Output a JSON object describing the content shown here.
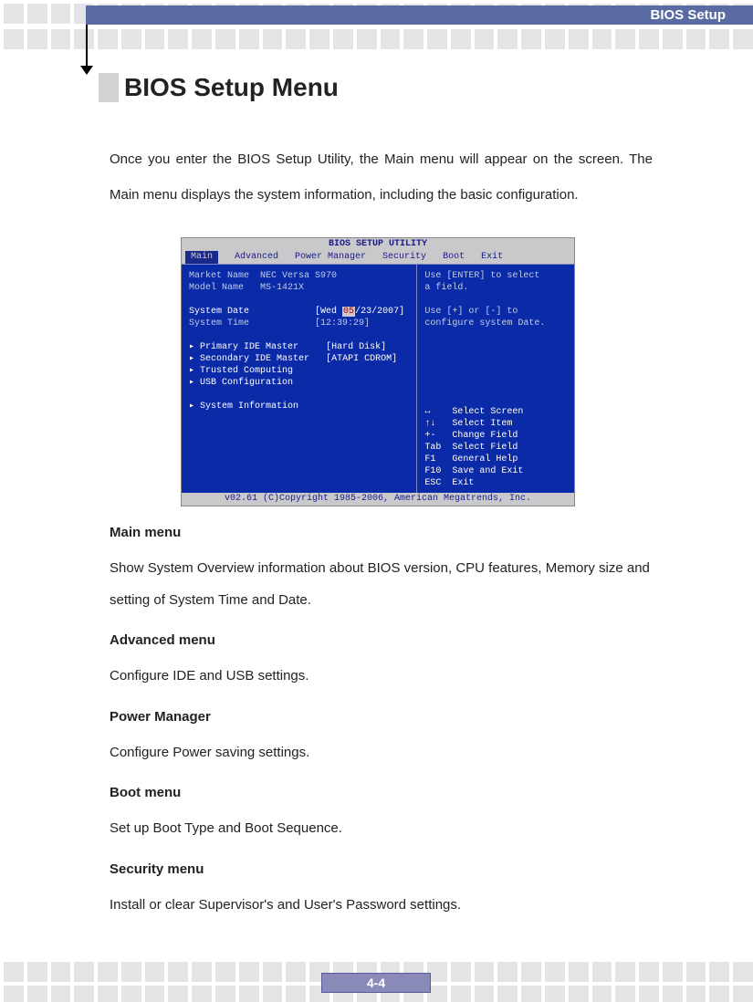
{
  "header": {
    "title": "BIOS Setup"
  },
  "heading": "BIOS Setup Menu",
  "intro": "Once you enter the BIOS Setup Utility, the Main menu will appear on the screen. The Main menu displays the system information, including the basic configuration.",
  "bios": {
    "title": "BIOS SETUP UTILITY",
    "tabs": [
      "Main",
      "Advanced",
      "Power Manager",
      "Security",
      "Boot",
      "Exit"
    ],
    "market_label": "Market Name",
    "market_value": "NEC Versa S970",
    "model_label": "Model Name",
    "model_value": "MS-1421X",
    "date_label": "System Date",
    "date_value_pre": "[Wed ",
    "date_value_hl": "05",
    "date_value_post": "/23/2007]",
    "time_label": "System Time",
    "time_value": "[12:39:29]",
    "items": [
      {
        "label": "Primary IDE Master",
        "value": "[Hard Disk]"
      },
      {
        "label": "Secondary IDE Master",
        "value": "[ATAPI CDROM]"
      },
      {
        "label": "Trusted Computing",
        "value": ""
      },
      {
        "label": "USB Configuration",
        "value": ""
      }
    ],
    "sysinfo": "System Information",
    "help1": "Use [ENTER] to select",
    "help2": "a field.",
    "help3": "Use [+] or [-] to",
    "help4": "configure system Date.",
    "nav": [
      "↔    Select Screen",
      "↑↓   Select Item",
      "+-   Change Field",
      "Tab  Select Field",
      "F1   General Help",
      "F10  Save and Exit",
      "ESC  Exit"
    ],
    "footer": "v02.61 (C)Copyright 1985-2006, American Megatrends, Inc."
  },
  "sections": [
    {
      "title": "Main menu",
      "desc": "Show System Overview information about BIOS version, CPU features, Memory size and setting of System Time and Date."
    },
    {
      "title": "Advanced menu",
      "desc": "Configure IDE and USB settings."
    },
    {
      "title": "Power Manager",
      "desc": "Configure Power saving settings."
    },
    {
      "title": "Boot menu",
      "desc": "Set up Boot Type and Boot Sequence."
    },
    {
      "title": "Security menu",
      "desc": "Install or clear Supervisor's and User's Password settings."
    }
  ],
  "page_number": "4-4"
}
